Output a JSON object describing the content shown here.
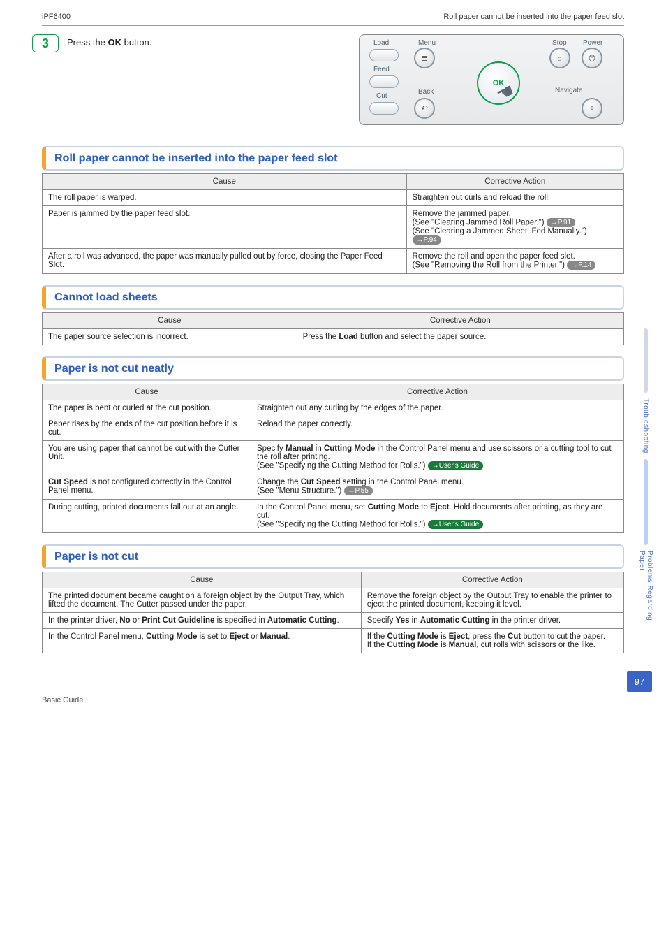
{
  "header": {
    "left": "iPF6400",
    "right": "Roll paper cannot be inserted into the paper feed slot"
  },
  "step": {
    "number": "3",
    "text_prefix": "Press the ",
    "button_label": "OK",
    "text_suffix": " button."
  },
  "panel": {
    "load": "Load",
    "feed": "Feed",
    "cut": "Cut",
    "menu": "Menu",
    "back": "Back",
    "stop": "Stop",
    "power": "Power",
    "navigate": "Navigate",
    "ok": "OK"
  },
  "columns": {
    "cause": "Cause",
    "action": "Corrective Action"
  },
  "sections": [
    {
      "title": "Roll paper cannot be inserted into the paper feed slot",
      "rows": [
        {
          "cause": "The roll paper is warped.",
          "action_parts": [
            "Straighten out curls and reload the roll."
          ]
        },
        {
          "cause": "Paper is jammed by the paper feed slot.",
          "action_parts": [
            "Remove the jammed paper.",
            "(See \"Clearing Jammed Roll Paper.\") ",
            {
              "pill": "→P.91"
            },
            "(See \"Clearing a Jammed Sheet, Fed Manually.\") ",
            {
              "pill": "→P.94"
            }
          ]
        },
        {
          "cause": "After a roll was advanced, the paper was manually pulled out by force, closing the Paper Feed Slot.",
          "action_parts": [
            "Remove the roll and open the paper feed slot.",
            "(See \"Removing the Roll from the Printer.\") ",
            {
              "pill": "→P.14"
            }
          ]
        }
      ]
    },
    {
      "title": "Cannot load sheets",
      "small": true,
      "rows": [
        {
          "cause": "The paper source selection is incorrect.",
          "action_parts": [
            "Press the <b>Load</b> button and select the paper source."
          ]
        }
      ]
    },
    {
      "title": "Paper is not cut neatly",
      "rows": [
        {
          "cause": "The paper is bent or curled at the cut position.",
          "action_parts": [
            "Straighten out any curling by the edges of the paper."
          ]
        },
        {
          "cause": "Paper rises by the ends of the cut position before it is cut.",
          "action_parts": [
            "Reload the paper correctly."
          ]
        },
        {
          "cause": "You are using paper that cannot be cut with the Cutter Unit.",
          "action_parts": [
            "Specify <b>Manual</b> in <b>Cutting Mode</b> in the Control Panel menu and use scissors or a cutting tool to cut the roll after printing.",
            "(See \"Specifying the Cutting Method for Rolls.\") ",
            {
              "pill_green": "→User's Guide"
            }
          ]
        },
        {
          "cause": "<b>Cut Speed</b> is not configured correctly in the Control Panel menu.",
          "action_parts": [
            "Change the <b>Cut Speed</b> setting in the Control Panel menu.",
            "(See \"Menu Structure.\") ",
            {
              "pill": "→P.55"
            }
          ]
        },
        {
          "cause": "During cutting, printed documents fall out at an angle.",
          "action_parts": [
            "In the Control Panel menu, set <b>Cutting Mode</b> to <b>Eject</b>. Hold documents after printing, as they are cut.",
            "(See \"Specifying the Cutting Method for Rolls.\") ",
            {
              "pill_green": "→User's Guide"
            }
          ]
        }
      ]
    },
    {
      "title": "Paper is not cut",
      "rows": [
        {
          "cause": "The printed document became caught on a foreign object by the Output Tray, which lifted the document. The Cutter passed under the paper.",
          "action_parts": [
            "Remove the foreign object by the Output Tray to enable the printer to eject the printed document, keeping it level."
          ]
        },
        {
          "cause": "In the printer driver, <b>No</b> or <b>Print Cut Guideline</b> is specified in <b>Automatic Cutting</b>.",
          "action_parts": [
            "Specify <b>Yes</b> in <b>Automatic Cutting</b> in the printer driver."
          ]
        },
        {
          "cause": "In the Control Panel menu, <b>Cutting Mode</b> is set to <b>Eject</b> or <b>Manual</b>.",
          "action_parts": [
            "If the <b>Cutting Mode</b> is <b>Eject</b>, press the <b>Cut</b> button to cut the paper.",
            "If the <b>Cutting Mode</b> is <b>Manual</b>, cut rolls with scissors or the like."
          ]
        }
      ]
    }
  ],
  "sidebar": {
    "a": "Troubleshooting",
    "b": "Problems Regarding Paper"
  },
  "page_number": "97",
  "footer": "Basic Guide"
}
